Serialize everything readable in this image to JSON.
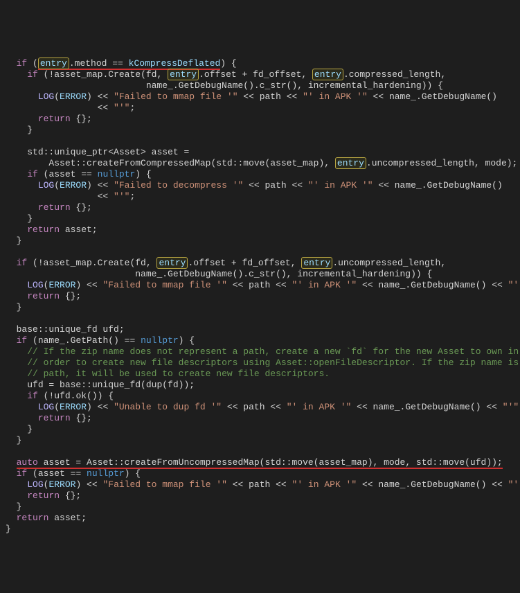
{
  "tokens": {
    "entry": "entry",
    "nullptr": "nullptr",
    "if": "if",
    "return": "return",
    "auto": "auto",
    "LOG": "LOG",
    "ERROR": "ERROR",
    "method": ".method == ",
    "kCompressDeflated": "kCompressDeflated",
    "asset_map_create_fd": "(!asset_map.Create(fd, ",
    "offset_fd_offset": ".offset + fd_offset, ",
    "compressed_length": ".compressed_length,",
    "uncompressed_length": ".uncompressed_length,",
    "uncompressed_length_mode": ".uncompressed_length, mode);",
    "name_getdebug_incremental": "name_.GetDebugName().c_str(), incremental_hardening)) {",
    "failed_mmap": "\"Failed to mmap file '\"",
    "path_mid": " << path << ",
    "in_apk": "\"' in APK '\"",
    "name_getdebug": " << name_.GetDebugName()",
    "name_getdebug_tail": " << name_.GetDebugName() << ",
    "endq": "\"'\"",
    "semicolon": ";",
    "ll": "             << ",
    "empty_braces": " {};",
    "brace_close": "}",
    "unique_ptr_asset": "std::unique_ptr<Asset> asset =",
    "create_compressed": "Asset::createFromCompressedMap(std::move(asset_map), ",
    "asset_eq_null_open": "(asset == ",
    "asset_eq_null_close": ") {",
    "failed_decompress": "\"Failed to decompress '\"",
    "return_asset": " asset;",
    "base_unique_fd_ufd": "base::unique_fd ufd;",
    "name_getpath_null": "(name_.GetPath() == ",
    "cmt1": "// If the zip name does not represent a path, create a new `fd` for the new Asset to own in",
    "cmt2": "// order to create new file descriptors using Asset::openFileDescriptor. If the zip name is a",
    "cmt3": "// path, it will be used to create new file descriptors.",
    "ufd_dup": "ufd = base::unique_fd(dup(fd));",
    "ufd_ok": "(!ufd.ok()) {",
    "unable_dup": "\"Unable to dup fd '\"",
    "auto_asset_line": " asset = Asset::createFromUncompressedMap(std::move(asset_map), mode, std::move(ufd));",
    "log_open": "(",
    "log_close": ") << ",
    "sp2": "  ",
    "sp4": "    ",
    "sp6": "      ",
    "sp8": "        ",
    "sp26": "                          ",
    "sp8_indent_create": "        ",
    "sp_name_indent": "                              "
  }
}
